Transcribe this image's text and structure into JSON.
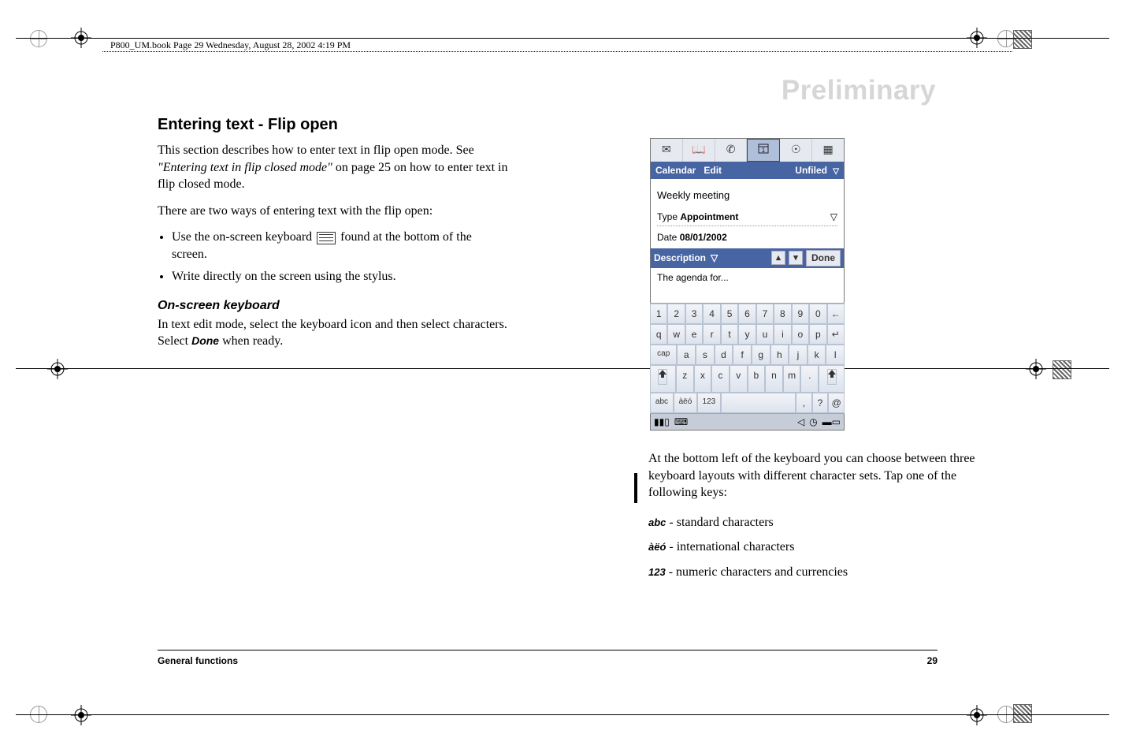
{
  "header_line": "P800_UM.book  Page 29  Wednesday, August 28, 2002  4:19 PM",
  "watermark": "Preliminary",
  "left": {
    "title": "Entering text - Flip open",
    "p1a": "This section describes how to enter text in flip open mode. See ",
    "p1b": "\"Entering text in flip closed mode\"",
    "p1c": " on page 25 on how to enter text in flip closed mode.",
    "p2": "There are two ways of entering text with the flip open:",
    "b1a": "Use the on-screen keyboard ",
    "b1b": " found at the bottom of the screen.",
    "b2": "Write directly on the screen using the stylus.",
    "subhead": "On-screen keyboard",
    "p3a": "In text edit mode, select the keyboard icon and then select characters. Select ",
    "p3b": "Done",
    "p3c": " when ready."
  },
  "device": {
    "menubar": {
      "left1": "Calendar",
      "left2": "Edit",
      "right": "Unfiled"
    },
    "body": {
      "title": "Weekly meeting",
      "type_label": "Type",
      "type_value": "Appointment",
      "date_label": "Date",
      "date_value": "08/01/2002",
      "desc_label": "Description",
      "done": "Done",
      "textarea": "The agenda for..."
    },
    "keyboard": {
      "row1": [
        "1",
        "2",
        "3",
        "4",
        "5",
        "6",
        "7",
        "8",
        "9",
        "0",
        "←"
      ],
      "row2": [
        "q",
        "w",
        "e",
        "r",
        "t",
        "y",
        "u",
        "i",
        "o",
        "p",
        "↵"
      ],
      "row3_first": "cap",
      "row3": [
        "a",
        "s",
        "d",
        "f",
        "g",
        "h",
        "j",
        "k",
        "l"
      ],
      "row4": [
        "z",
        "x",
        "c",
        "v",
        "b",
        "n",
        "m",
        "."
      ],
      "row5": [
        "abc",
        "àëó",
        "123",
        ",",
        "?",
        "@"
      ]
    }
  },
  "right": {
    "p1": "At the bottom left of the keyboard you can choose between three keyboard layouts with different character sets. Tap one of the following keys:",
    "k1": "abc",
    "d1": " - standard characters",
    "k2": "àëó",
    "d2": " - international characters",
    "k3": "123",
    "d3": " - numeric characters and currencies"
  },
  "footer": {
    "section": "General functions",
    "page": "29"
  }
}
